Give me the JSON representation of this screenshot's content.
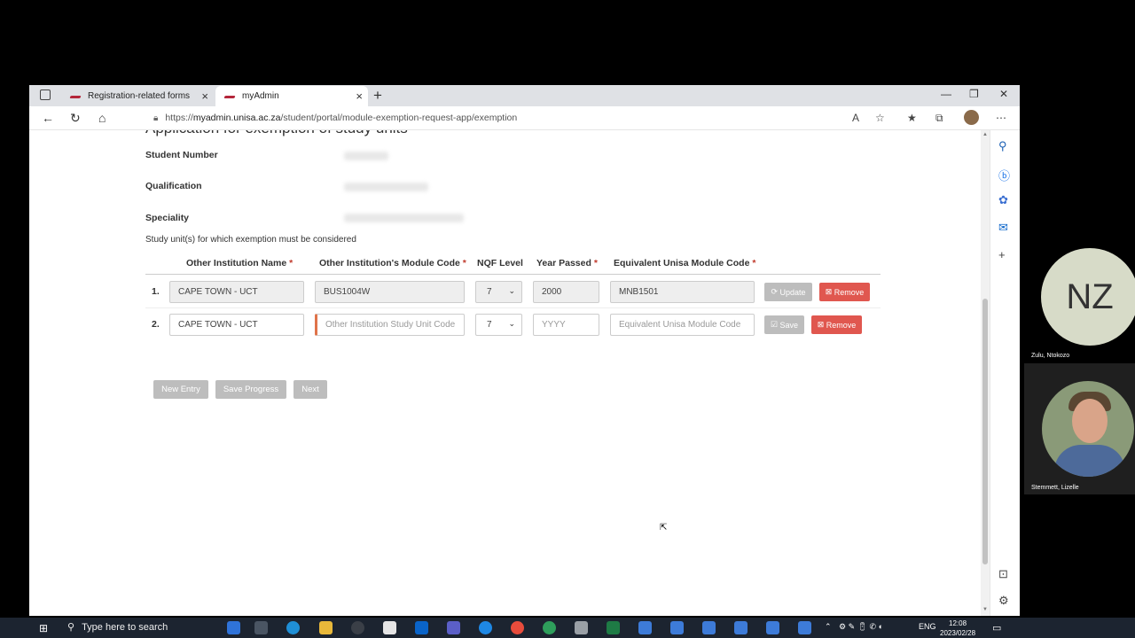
{
  "browser": {
    "tabs": [
      {
        "title": "Registration-related forms",
        "active": false
      },
      {
        "title": "myAdmin",
        "active": true
      }
    ],
    "url_prefix": "https://",
    "url_host": "myadmin.unisa.ac.za",
    "url_path": "/student/portal/module-exemption-request-app/exemption"
  },
  "page": {
    "title": "Application for exemption of study units",
    "labels": {
      "student_number": "Student Number",
      "qualification": "Qualification",
      "speciality": "Speciality"
    },
    "study_note": "Study unit(s) for which exemption must be considered",
    "columns": [
      "Other Institution Name",
      "Other Institution's Module Code",
      "NQF Level",
      "Year Passed",
      "Equivalent Unisa Module Code"
    ],
    "required_mark": "*",
    "rows": [
      {
        "num": "1.",
        "institution": "CAPE TOWN - UCT",
        "module_code": "BUS1004W",
        "nqf": "7",
        "year": "2000",
        "unisa_code": "MNB1501",
        "action": "Update",
        "remove": "Remove"
      },
      {
        "num": "2.",
        "institution": "CAPE TOWN - UCT",
        "module_code_placeholder": "Other Institution Study Unit Code",
        "nqf": "7",
        "year_placeholder": "YYYY",
        "unisa_code_placeholder": "Equivalent Unisa Module Code",
        "action": "Save",
        "remove": "Remove"
      }
    ],
    "buttons": {
      "new_entry": "New Entry",
      "save_progress": "Save Progress",
      "next": "Next"
    }
  },
  "call": {
    "participant1_initials": "NZ",
    "participant1_name": "Zulu, Ntokozo",
    "participant2_name": "Stemmett, Lizelle"
  },
  "taskbar": {
    "search_placeholder": "Type here to search",
    "language": "ENG",
    "time": "12:08",
    "date": "2023/02/28"
  }
}
